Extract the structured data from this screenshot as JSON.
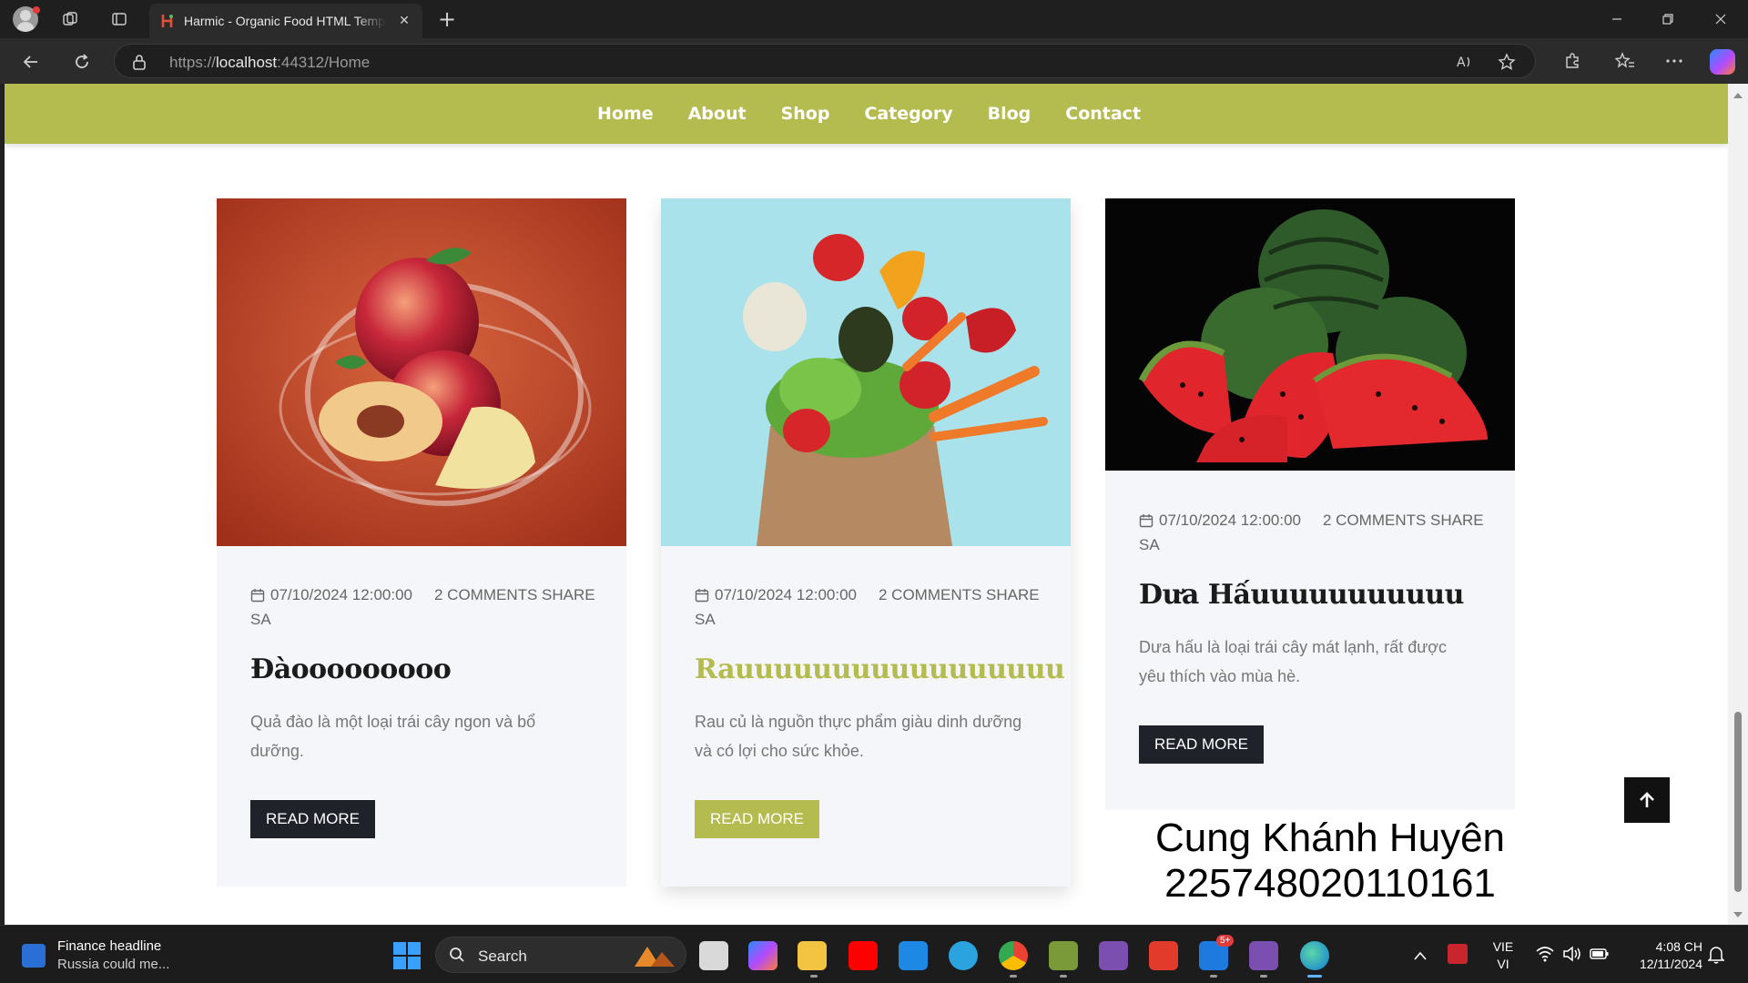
{
  "browser": {
    "tab_title": "Harmic - Organic Food HTML Template",
    "url_scheme": "https://",
    "url_host": "localhost",
    "url_path": ":44312/Home"
  },
  "site": {
    "accent_color": "#b4bb4f",
    "nav": [
      "Home",
      "About",
      "Shop",
      "Category",
      "Blog",
      "Contact"
    ]
  },
  "posts": [
    {
      "date": "07/10/2024 12:00:00 SA",
      "comments": "2 COMMENTS SHARE",
      "title": "Đàooooooooo",
      "excerpt": "Quả đào là một loại trái cây ngon và bổ dưỡng.",
      "button": "READ MORE",
      "image": "peach-splash-photo"
    },
    {
      "date": "07/10/2024 12:00:00 SA",
      "comments": "2 COMMENTS SHARE",
      "title": "Rauuuuuuuuuuuuuuuuu",
      "excerpt": "Rau củ là nguồn thực phẩm giàu dinh dưỡng và có lợi cho sức khỏe.",
      "button": "READ MORE",
      "image": "vegetables-paper-bag-photo"
    },
    {
      "date": "07/10/2024 12:00:00 SA",
      "comments": "2 COMMENTS SHARE",
      "title": "Dưa Hấuuuuuuuuuuu",
      "excerpt": "Dưa hấu là loại trái cây mát lạnh, rất được yêu thích vào mùa hè.",
      "button": "READ MORE",
      "image": "watermelon-photo"
    }
  ],
  "signature": {
    "name": "Cung Khánh Huyên",
    "id": "225748020110161"
  },
  "taskbar": {
    "news_title": "Finance headline",
    "news_sub": "Russia could me...",
    "search_placeholder": "Search",
    "lang_top": "VIE",
    "lang_bottom": "VI",
    "time": "4:08 CH",
    "date": "12/11/2024",
    "badge": "5+"
  }
}
